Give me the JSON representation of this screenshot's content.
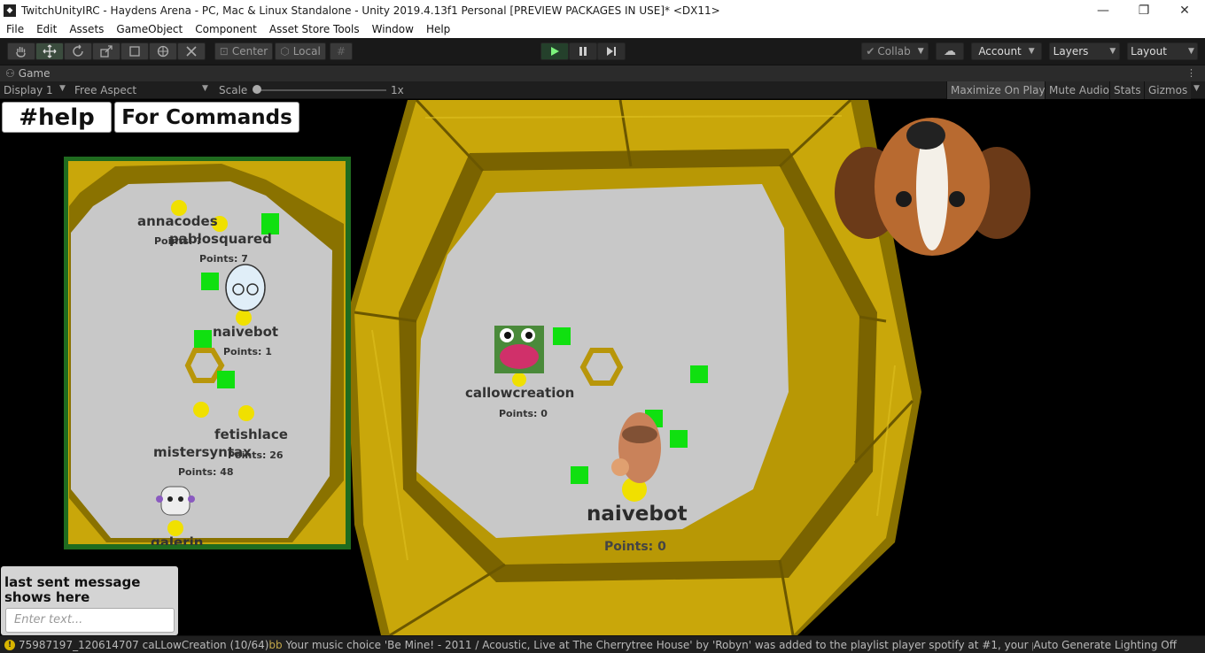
{
  "window": {
    "title": "TwitchUnityIRC - Haydens Arena - PC, Mac & Linux Standalone - Unity 2019.4.13f1 Personal [PREVIEW PACKAGES IN USE]* <DX11>",
    "minimize": "—",
    "maximize": "❐",
    "close": "✕"
  },
  "menu": [
    "File",
    "Edit",
    "Assets",
    "GameObject",
    "Component",
    "Asset Store Tools",
    "Window",
    "Help"
  ],
  "toolbar": {
    "pivot_center": "Center",
    "pivot_local": "Local",
    "collab": "Collab",
    "account": "Account",
    "layers": "Layers",
    "layout": "Layout"
  },
  "game_tab": {
    "label": "Game"
  },
  "game_bar": {
    "display": "Display 1",
    "aspect": "Free Aspect",
    "scale_label": "Scale",
    "scale_value": "1x",
    "maximize_on_play": "Maximize On Play",
    "mute_audio": "Mute Audio",
    "stats": "Stats",
    "gizmos": "Gizmos"
  },
  "game": {
    "help_banner": "#help",
    "commands_banner": "For Commands",
    "minimap_players": [
      {
        "name": "annacodes",
        "points": "Points: ?"
      },
      {
        "name": "pablosquared",
        "points": "Points: 7"
      },
      {
        "name": "naivebot",
        "points": "Points: 1"
      },
      {
        "name": "fetishlace",
        "points": "Points: 26"
      },
      {
        "name": "mistersyntax",
        "points": "Points: 48"
      },
      {
        "name": "galerin",
        "points": ""
      }
    ],
    "main_players": [
      {
        "name": "callowcreation",
        "points": "Points: 0"
      },
      {
        "name": "naivebot",
        "points": "Points: 0"
      }
    ],
    "chat": {
      "last_message": "last sent message shows here",
      "placeholder": "Enter text..."
    }
  },
  "status": {
    "console_prefix": "75987197_120614707 caLLowCreation (10/64)",
    "console_bb": "bb",
    "console_message": " Your music choice 'Be Mine! - 2011 / Acoustic, Live at The Cherrytree House' by 'Robyn' was added to the playlist player spotify at #1, your playlist en",
    "lighting": "Auto Generate Lighting Off"
  },
  "colors": {
    "arena_gold": "#c9a70a",
    "arena_dark": "#6b5700",
    "floor": "#c8c8c8",
    "minimap_border": "#1f6b1f",
    "cube": "#10e010",
    "ball": "#f0e000"
  }
}
